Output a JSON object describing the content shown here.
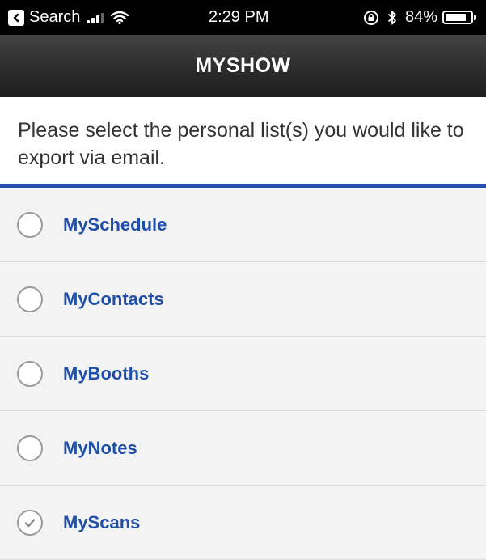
{
  "status_bar": {
    "back_label": "Search",
    "time": "2:29 PM",
    "battery": "84%",
    "battery_level": 0.84
  },
  "header": {
    "title": "MYSHOW"
  },
  "instructions": "Please select the personal list(s) you would like to export via email.",
  "colors": {
    "accent": "#1f4fa8",
    "label": "#1f4fa8"
  },
  "lists": [
    {
      "label": "MySchedule",
      "checked": false
    },
    {
      "label": "MyContacts",
      "checked": false
    },
    {
      "label": "MyBooths",
      "checked": false
    },
    {
      "label": "MyNotes",
      "checked": false
    },
    {
      "label": "MyScans",
      "checked": true
    }
  ]
}
